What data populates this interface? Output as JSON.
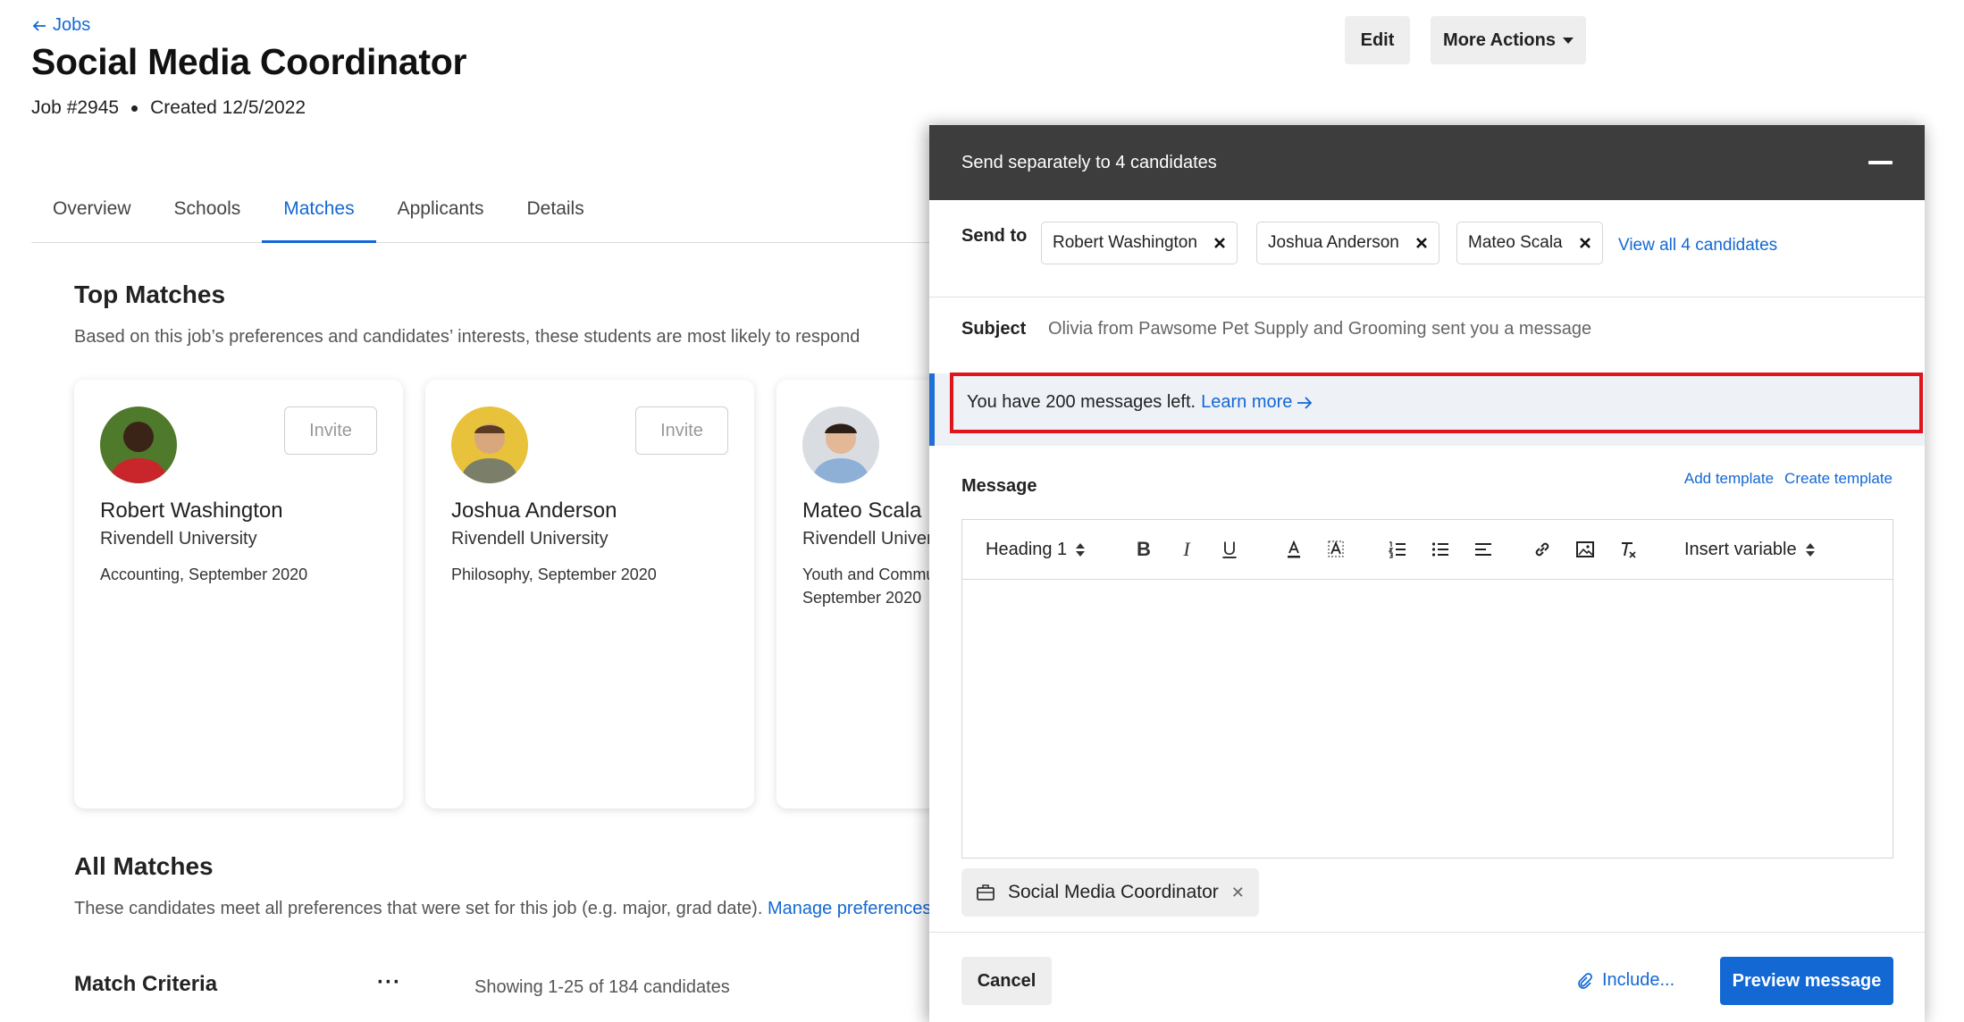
{
  "header": {
    "back_label": "Jobs",
    "title": "Social Media Coordinator",
    "job_number": "Job #2945",
    "created": "Created 12/5/2022",
    "edit_label": "Edit",
    "more_actions_label": "More Actions"
  },
  "tabs": [
    {
      "label": "Overview",
      "active": false
    },
    {
      "label": "Schools",
      "active": false
    },
    {
      "label": "Matches",
      "active": true
    },
    {
      "label": "Applicants",
      "active": false
    },
    {
      "label": "Details",
      "active": false
    }
  ],
  "top_matches": {
    "title": "Top Matches",
    "subtitle": "Based on this job’s preferences and candidates’ interests, these students are most likely to respond",
    "invite_label": "Invite",
    "cards": [
      {
        "name": "Robert Washington",
        "school": "Rivendell University",
        "major_line1": "Accounting, September 2020",
        "major_line2": ""
      },
      {
        "name": "Joshua Anderson",
        "school": "Rivendell University",
        "major_line1": "Philosophy, September 2020",
        "major_line2": ""
      },
      {
        "name": "Mateo Scala",
        "school": "Rivendell University",
        "major_line1": "Youth and Community",
        "major_line2": "September 2020"
      }
    ]
  },
  "all_matches": {
    "title": "All Matches",
    "subtitle": "These candidates meet all preferences that were set for this job (e.g. major, grad date).",
    "manage_link": "Manage preferences",
    "criteria_label": "Match Criteria",
    "more_label": "···",
    "showing_text": "Showing 1-25 of 184 candidates"
  },
  "compose": {
    "title": "Send separately to 4 candidates",
    "send_to_label": "Send to",
    "recipients": [
      "Robert Washington",
      "Joshua Anderson",
      "Mateo Scala"
    ],
    "view_all_label": "View all 4 candidates",
    "subject_label": "Subject",
    "subject_value": "Olivia from Pawsome Pet Supply and Grooming sent you a message",
    "notice_text": "You have 200 messages left.",
    "notice_link": "Learn more",
    "message_label": "Message",
    "add_template_label": "Add template",
    "create_template_label": "Create template",
    "toolbar": {
      "heading_select": "Heading 1",
      "bold": "B",
      "italic": "I",
      "underline": "U",
      "insert_variable": "Insert variable"
    },
    "attachment_label": "Social Media Coordinator",
    "cancel_label": "Cancel",
    "include_label": "Include...",
    "preview_label": "Preview message"
  },
  "colors": {
    "accent": "#1368d4",
    "panel_header": "#3d3d3d",
    "highlight_outline": "#e0151c",
    "notice_bg": "#eef1f6"
  }
}
